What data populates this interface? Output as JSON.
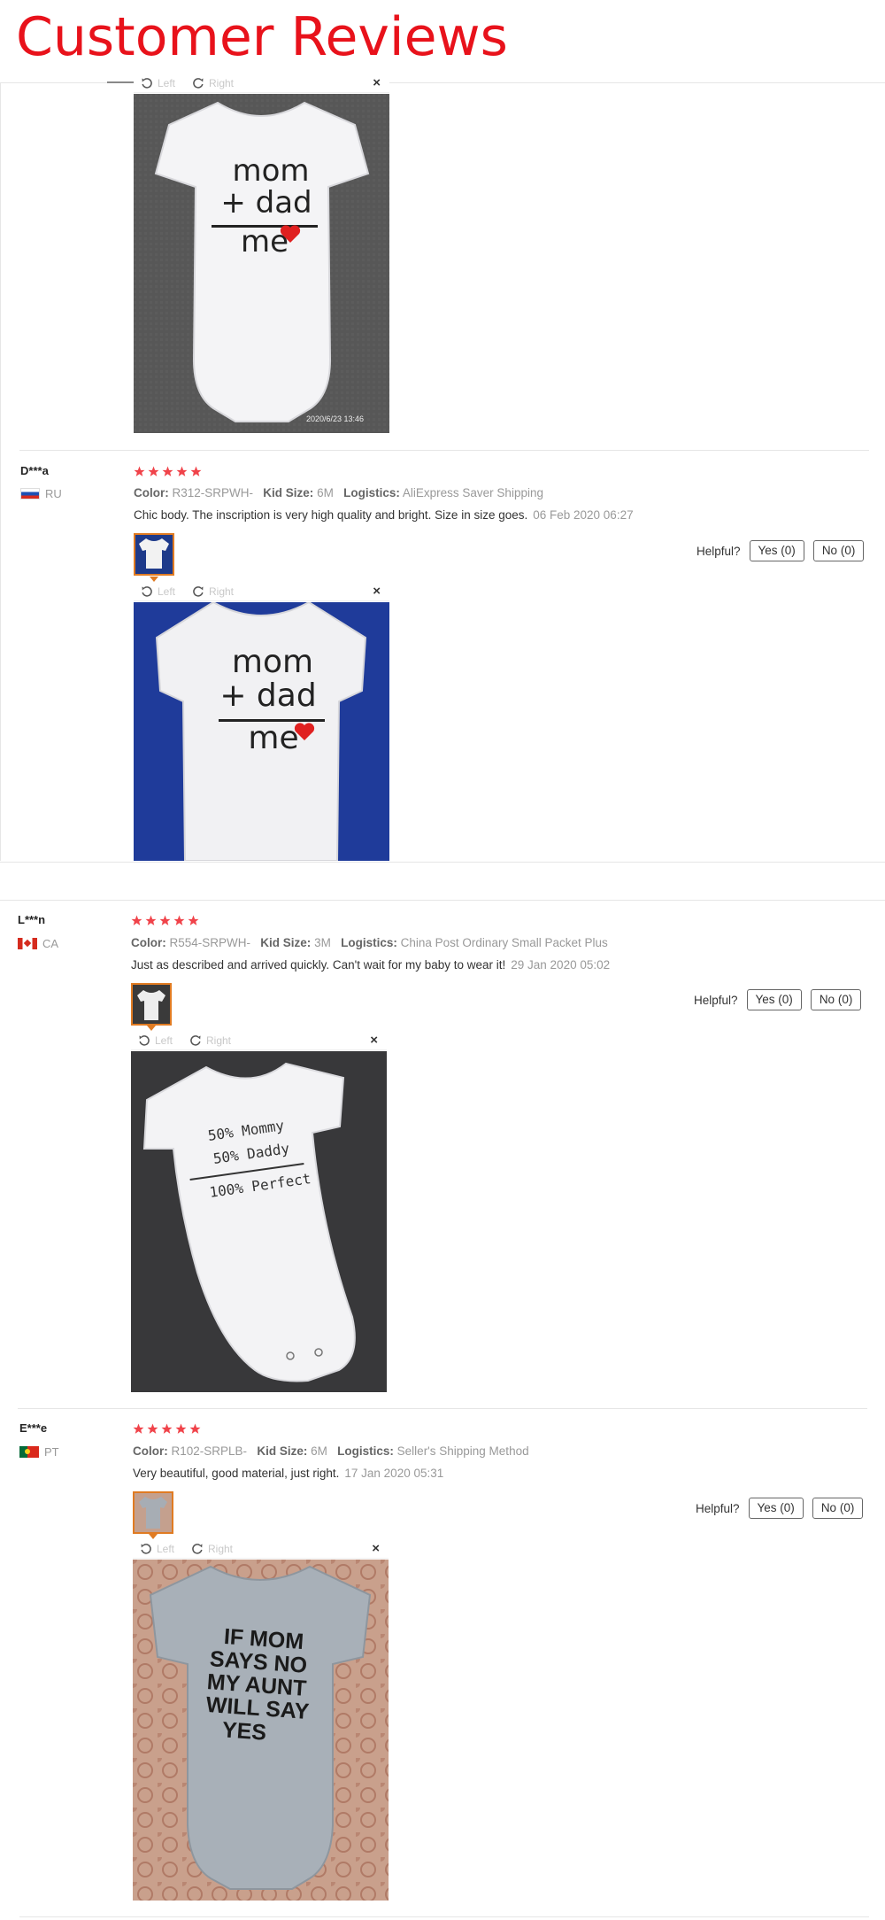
{
  "header": {
    "title": "Customer Reviews"
  },
  "viewer": {
    "left_label": "Left",
    "right_label": "Right",
    "close_glyph": "×"
  },
  "helpful_label": "Helpful?",
  "labels": {
    "color": "Color:",
    "kid_size": "Kid Size:",
    "logistics": "Logistics:"
  },
  "photo_text": {
    "mom_dad_me": [
      "mom",
      "+ dad",
      "me"
    ],
    "percent": [
      "50% Mommy",
      "50% Daddy",
      "100% Perfect"
    ],
    "aunt": [
      "IF MOM",
      "SAYS NO",
      "MY AUNT",
      "WILL SAY",
      "YES"
    ],
    "timestamp": "2020/6/23  13:46"
  },
  "reviews": [
    {
      "name": "D***a",
      "country": "RU",
      "rating": 5,
      "color": "R312-SRPWH-",
      "kid_size": "6M",
      "logistics": "AliExpress Saver Shipping",
      "text": "Chic body. The inscription is very high quality and bright. Size in size goes.",
      "date": "06 Feb 2020 06:27",
      "yes_label": "Yes (0)",
      "no_label": "No (0)"
    },
    {
      "name": "L***n",
      "country": "CA",
      "rating": 5,
      "color": "R554-SRPWH-",
      "kid_size": "3M",
      "logistics": "China Post Ordinary Small Packet Plus",
      "text": "Just as described and arrived quickly. Can't wait for my baby to wear it!",
      "date": "29 Jan 2020 05:02",
      "yes_label": "Yes (0)",
      "no_label": "No (0)"
    },
    {
      "name": "E***e",
      "country": "PT",
      "rating": 5,
      "color": "R102-SRPLB-",
      "kid_size": "6M",
      "logistics": "Seller's Shipping Method",
      "text": "Very beautiful, good material, just right.",
      "date": "17 Jan 2020 05:31",
      "yes_label": "Yes (0)",
      "no_label": "No (0)"
    }
  ],
  "colors": {
    "title": "#e8121b",
    "star": "#f0434a",
    "thumb_border": "#e07b22",
    "flag_ru": [
      "#ffffff",
      "#1c4fb3",
      "#d52b1e"
    ],
    "flag_ca": "#d52b1e",
    "flag_pt": [
      "#046a38",
      "#da291c"
    ]
  },
  "icons": [
    "rotate-left-icon",
    "rotate-right-icon",
    "close-icon",
    "star-icon",
    "flag-icon"
  ]
}
